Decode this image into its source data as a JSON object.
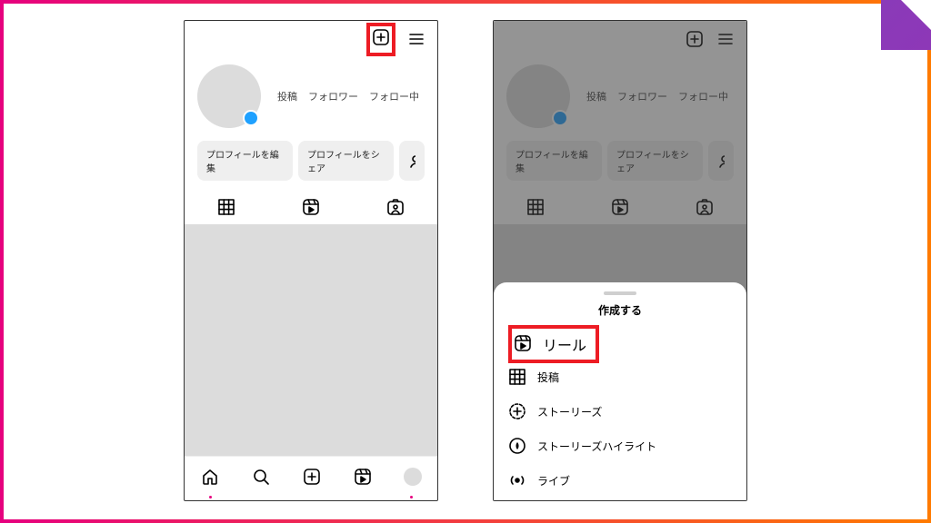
{
  "stats": {
    "posts": "投稿",
    "followers": "フォロワー",
    "following": "フォロー中"
  },
  "buttons": {
    "edit": "プロフィールを編集",
    "share": "プロフィールをシェア"
  },
  "sheet": {
    "title": "作成する",
    "reel": "リール",
    "post": "投稿",
    "story": "ストーリーズ",
    "highlight": "ストーリーズハイライト",
    "live": "ライブ"
  }
}
